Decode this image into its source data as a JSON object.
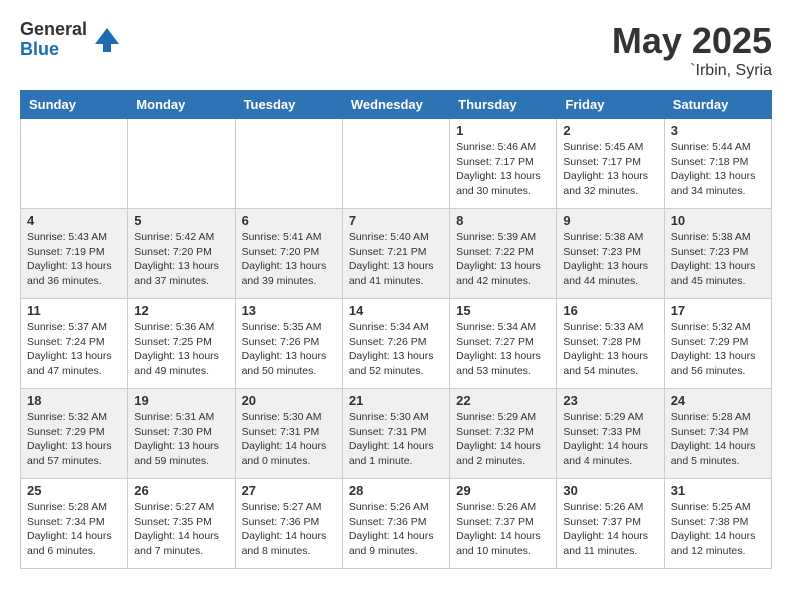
{
  "header": {
    "logo_general": "General",
    "logo_blue": "Blue",
    "month_year": "May 2025",
    "location": "`Irbin, Syria"
  },
  "weekdays": [
    "Sunday",
    "Monday",
    "Tuesday",
    "Wednesday",
    "Thursday",
    "Friday",
    "Saturday"
  ],
  "weeks": [
    [
      {
        "day": "",
        "info": ""
      },
      {
        "day": "",
        "info": ""
      },
      {
        "day": "",
        "info": ""
      },
      {
        "day": "",
        "info": ""
      },
      {
        "day": "1",
        "info": "Sunrise: 5:46 AM\nSunset: 7:17 PM\nDaylight: 13 hours\nand 30 minutes."
      },
      {
        "day": "2",
        "info": "Sunrise: 5:45 AM\nSunset: 7:17 PM\nDaylight: 13 hours\nand 32 minutes."
      },
      {
        "day": "3",
        "info": "Sunrise: 5:44 AM\nSunset: 7:18 PM\nDaylight: 13 hours\nand 34 minutes."
      }
    ],
    [
      {
        "day": "4",
        "info": "Sunrise: 5:43 AM\nSunset: 7:19 PM\nDaylight: 13 hours\nand 36 minutes."
      },
      {
        "day": "5",
        "info": "Sunrise: 5:42 AM\nSunset: 7:20 PM\nDaylight: 13 hours\nand 37 minutes."
      },
      {
        "day": "6",
        "info": "Sunrise: 5:41 AM\nSunset: 7:20 PM\nDaylight: 13 hours\nand 39 minutes."
      },
      {
        "day": "7",
        "info": "Sunrise: 5:40 AM\nSunset: 7:21 PM\nDaylight: 13 hours\nand 41 minutes."
      },
      {
        "day": "8",
        "info": "Sunrise: 5:39 AM\nSunset: 7:22 PM\nDaylight: 13 hours\nand 42 minutes."
      },
      {
        "day": "9",
        "info": "Sunrise: 5:38 AM\nSunset: 7:23 PM\nDaylight: 13 hours\nand 44 minutes."
      },
      {
        "day": "10",
        "info": "Sunrise: 5:38 AM\nSunset: 7:23 PM\nDaylight: 13 hours\nand 45 minutes."
      }
    ],
    [
      {
        "day": "11",
        "info": "Sunrise: 5:37 AM\nSunset: 7:24 PM\nDaylight: 13 hours\nand 47 minutes."
      },
      {
        "day": "12",
        "info": "Sunrise: 5:36 AM\nSunset: 7:25 PM\nDaylight: 13 hours\nand 49 minutes."
      },
      {
        "day": "13",
        "info": "Sunrise: 5:35 AM\nSunset: 7:26 PM\nDaylight: 13 hours\nand 50 minutes."
      },
      {
        "day": "14",
        "info": "Sunrise: 5:34 AM\nSunset: 7:26 PM\nDaylight: 13 hours\nand 52 minutes."
      },
      {
        "day": "15",
        "info": "Sunrise: 5:34 AM\nSunset: 7:27 PM\nDaylight: 13 hours\nand 53 minutes."
      },
      {
        "day": "16",
        "info": "Sunrise: 5:33 AM\nSunset: 7:28 PM\nDaylight: 13 hours\nand 54 minutes."
      },
      {
        "day": "17",
        "info": "Sunrise: 5:32 AM\nSunset: 7:29 PM\nDaylight: 13 hours\nand 56 minutes."
      }
    ],
    [
      {
        "day": "18",
        "info": "Sunrise: 5:32 AM\nSunset: 7:29 PM\nDaylight: 13 hours\nand 57 minutes."
      },
      {
        "day": "19",
        "info": "Sunrise: 5:31 AM\nSunset: 7:30 PM\nDaylight: 13 hours\nand 59 minutes."
      },
      {
        "day": "20",
        "info": "Sunrise: 5:30 AM\nSunset: 7:31 PM\nDaylight: 14 hours\nand 0 minutes."
      },
      {
        "day": "21",
        "info": "Sunrise: 5:30 AM\nSunset: 7:31 PM\nDaylight: 14 hours\nand 1 minute."
      },
      {
        "day": "22",
        "info": "Sunrise: 5:29 AM\nSunset: 7:32 PM\nDaylight: 14 hours\nand 2 minutes."
      },
      {
        "day": "23",
        "info": "Sunrise: 5:29 AM\nSunset: 7:33 PM\nDaylight: 14 hours\nand 4 minutes."
      },
      {
        "day": "24",
        "info": "Sunrise: 5:28 AM\nSunset: 7:34 PM\nDaylight: 14 hours\nand 5 minutes."
      }
    ],
    [
      {
        "day": "25",
        "info": "Sunrise: 5:28 AM\nSunset: 7:34 PM\nDaylight: 14 hours\nand 6 minutes."
      },
      {
        "day": "26",
        "info": "Sunrise: 5:27 AM\nSunset: 7:35 PM\nDaylight: 14 hours\nand 7 minutes."
      },
      {
        "day": "27",
        "info": "Sunrise: 5:27 AM\nSunset: 7:36 PM\nDaylight: 14 hours\nand 8 minutes."
      },
      {
        "day": "28",
        "info": "Sunrise: 5:26 AM\nSunset: 7:36 PM\nDaylight: 14 hours\nand 9 minutes."
      },
      {
        "day": "29",
        "info": "Sunrise: 5:26 AM\nSunset: 7:37 PM\nDaylight: 14 hours\nand 10 minutes."
      },
      {
        "day": "30",
        "info": "Sunrise: 5:26 AM\nSunset: 7:37 PM\nDaylight: 14 hours\nand 11 minutes."
      },
      {
        "day": "31",
        "info": "Sunrise: 5:25 AM\nSunset: 7:38 PM\nDaylight: 14 hours\nand 12 minutes."
      }
    ]
  ]
}
